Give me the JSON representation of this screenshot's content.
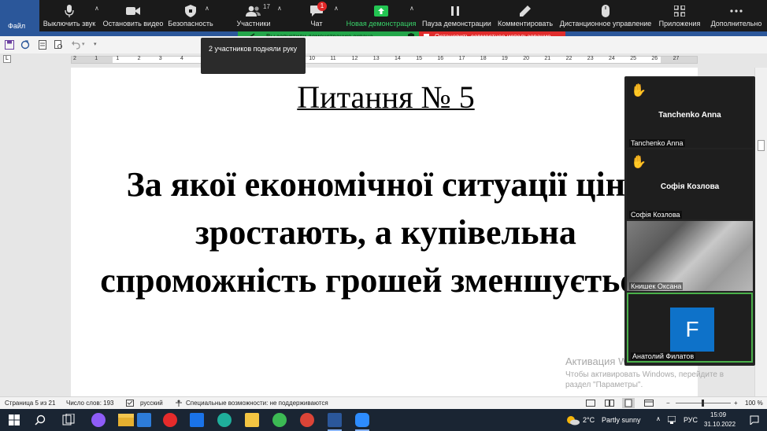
{
  "word": {
    "file_tab": "Файл",
    "page_title": "Питання № 5",
    "question": "За якої економічної ситуації ціни зростають, а купівельна спроможність грошей зменшується?"
  },
  "zoom_toolbar": {
    "mute": "Выключить звук",
    "video": "Остановить видео",
    "security": "Безопасность",
    "participants": "Участники",
    "participants_count": "17",
    "chat": "Чат",
    "chat_badge": "1",
    "new_share": "Новая демонстрация",
    "pause_share": "Пауза демонстрации",
    "annotate": "Комментировать",
    "remote_control": "Дистанционное управление",
    "apps": "Приложения",
    "more": "Дополнительно"
  },
  "share_banner": {
    "status": "Вы запустили демонстрацию экрана",
    "stop": "Остановить совместное использование"
  },
  "tooltip": {
    "text": "2 участников подняли руку"
  },
  "gallery": {
    "tiles": [
      {
        "name": "Tanchenko Anna",
        "tag": "Tanchenko Anna",
        "hand": "✋"
      },
      {
        "name": "Софія Козлова",
        "tag": "Софія Козлова",
        "hand": "✋"
      },
      {
        "name": "",
        "tag": "Книшек Оксана"
      },
      {
        "name": "F",
        "tag": "Анатолий Филатов"
      }
    ]
  },
  "activation": {
    "title": "Активация Windows",
    "subtitle": "Чтобы активировать Windows, перейдите в раздел \"Параметры\"."
  },
  "statusbar": {
    "page": "Страница 5 из 21",
    "words": "Число слов: 193",
    "language": "русский",
    "accessibility": "Специальные возможности: не поддерживаются",
    "zoom": "100 %"
  },
  "taskbar": {
    "weather_temp": "2°C",
    "weather_text": "Partly sunny",
    "language": "РУС",
    "time": "15:09",
    "date": "31.10.2022"
  },
  "ruler_numbers": [
    "2",
    "1",
    "1",
    "2",
    "3",
    "4",
    "5",
    "6",
    "7",
    "8",
    "9",
    "10",
    "11",
    "12",
    "13",
    "14",
    "15",
    "16",
    "17",
    "18",
    "19",
    "20",
    "21",
    "22",
    "23",
    "24",
    "25",
    "26",
    "27"
  ],
  "colors": {
    "zoom_bar": "#1a1a1a",
    "share_green": "#23a64a",
    "stop_red": "#e02c2c",
    "word_blue": "#2b579a",
    "taskbar": "#1a2533",
    "avatar_blue": "#0e72c9",
    "hand_yellow": "#f2b600"
  }
}
